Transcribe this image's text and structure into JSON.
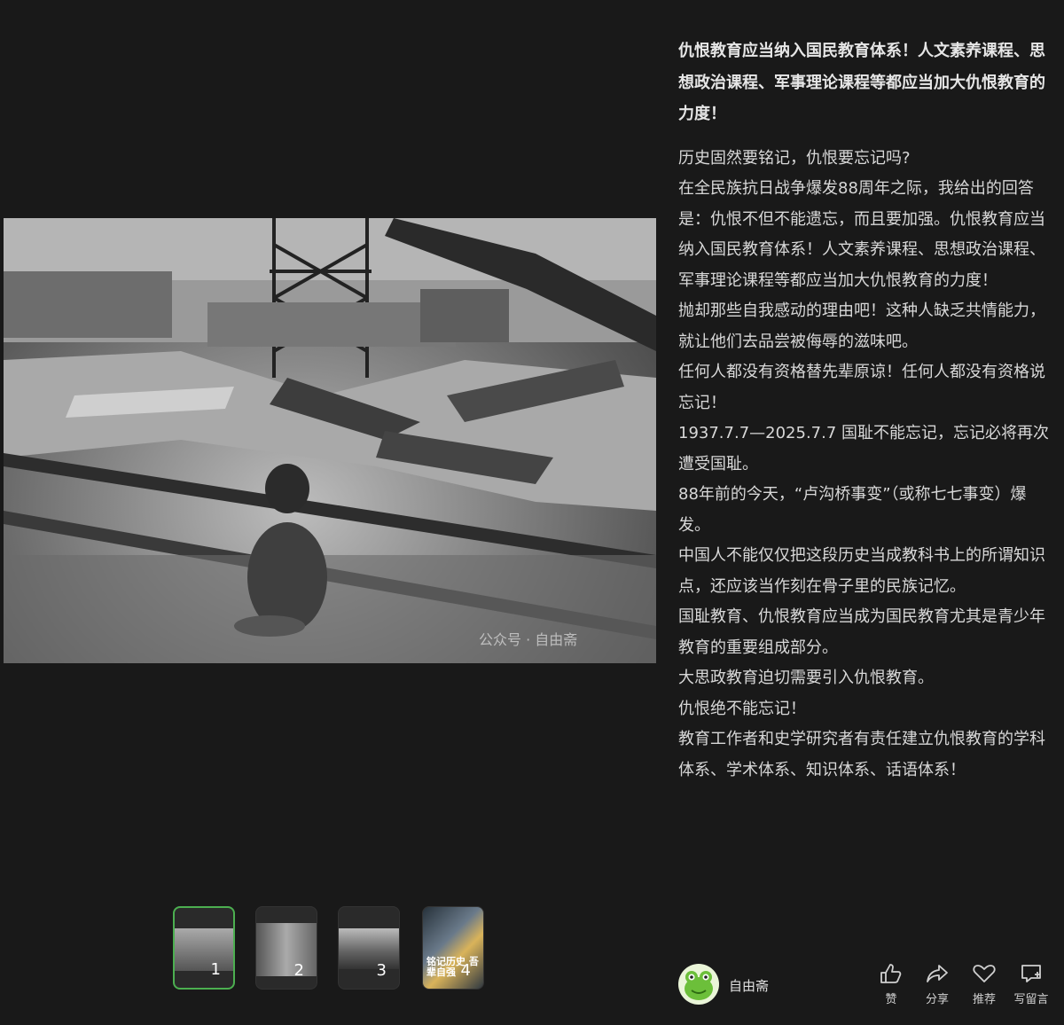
{
  "viewer": {
    "watermark": "公众号 · 自由斋",
    "thumbnails": [
      {
        "number": "1",
        "active": true
      },
      {
        "number": "2",
        "active": false
      },
      {
        "number": "3",
        "active": false
      },
      {
        "number": "4",
        "active": false,
        "caption": "铭记历史 吾辈自强"
      }
    ]
  },
  "article": {
    "headline": "仇恨教育应当纳入国民教育体系！人文素养课程、思想政治课程、军事理论课程等都应当加大仇恨教育的力度！",
    "paragraphs": [
      "历史固然要铭记，仇恨要忘记吗?",
      "",
      "在全民族抗日战争爆发88周年之际，我给出的回答是：仇恨不但不能遗忘，而且要加强。仇恨教育应当纳入国民教育体系！人文素养课程、思想政治课程、军事理论课程等都应当加大仇恨教育的力度！",
      "",
      "抛却那些自我感动的理由吧！这种人缺乏共情能力，就让他们去品尝被侮辱的滋味吧。",
      "",
      "任何人都没有资格替先辈原谅！任何人都没有资格说忘记！",
      "",
      "1937.7.7—2025.7.7 国耻不能忘记，忘记必将再次遭受国耻。",
      "88年前的今天，“卢沟桥事变”（或称七七事变）爆发。",
      "中国人不能仅仅把这段历史当成教科书上的所谓知识点，还应该当作刻在骨子里的民族记忆。",
      "国耻教育、仇恨教育应当成为国民教育尤其是青少年教育的重要组成部分。",
      "大思政教育迫切需要引入仇恨教育。",
      "",
      "仇恨绝不能忘记！",
      "教育工作者和史学研究者有责任建立仇恨教育的学科体系、学术体系、知识体系、话语体系！"
    ]
  },
  "footer": {
    "author": "自由斋",
    "actions": {
      "like": "赞",
      "share": "分享",
      "recommend": "推荐",
      "comment": "写留言"
    }
  }
}
